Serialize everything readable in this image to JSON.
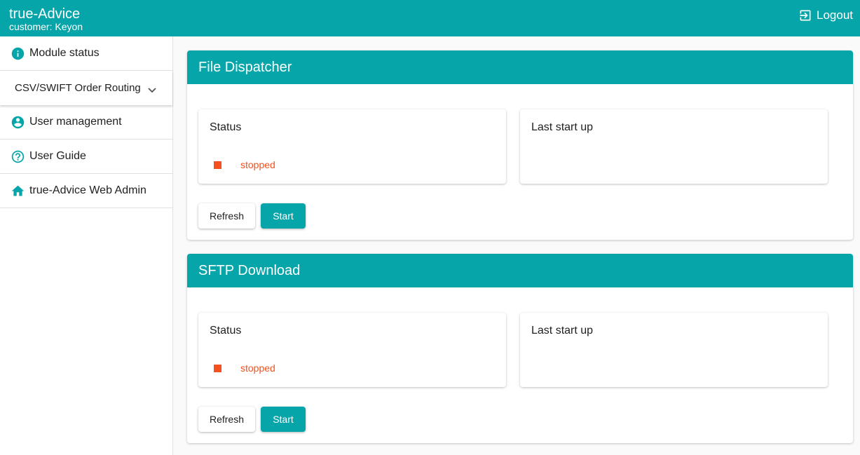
{
  "header": {
    "title": "true-Advice",
    "customer": "customer: Keyon",
    "logout_label": "Logout"
  },
  "sidebar": {
    "items": [
      {
        "label": "Module status",
        "icon": "info-icon"
      },
      {
        "label": "CSV/SWIFT Order Routing",
        "icon": "chevron-down-icon"
      },
      {
        "label": "User management",
        "icon": "account-circle-icon"
      },
      {
        "label": "User Guide",
        "icon": "help-circle-icon"
      },
      {
        "label": "true-Advice Web Admin",
        "icon": "home-icon"
      }
    ]
  },
  "modules": [
    {
      "title": "File Dispatcher",
      "status_label": "Status",
      "status_value": "stopped",
      "last_start_label": "Last start up",
      "refresh_label": "Refresh",
      "start_label": "Start"
    },
    {
      "title": "SFTP Download",
      "status_label": "Status",
      "status_value": "stopped",
      "last_start_label": "Last start up",
      "refresh_label": "Refresh",
      "start_label": "Start"
    }
  ],
  "colors": {
    "brand": "#06a5a9",
    "status_stopped": "#f4511e"
  }
}
